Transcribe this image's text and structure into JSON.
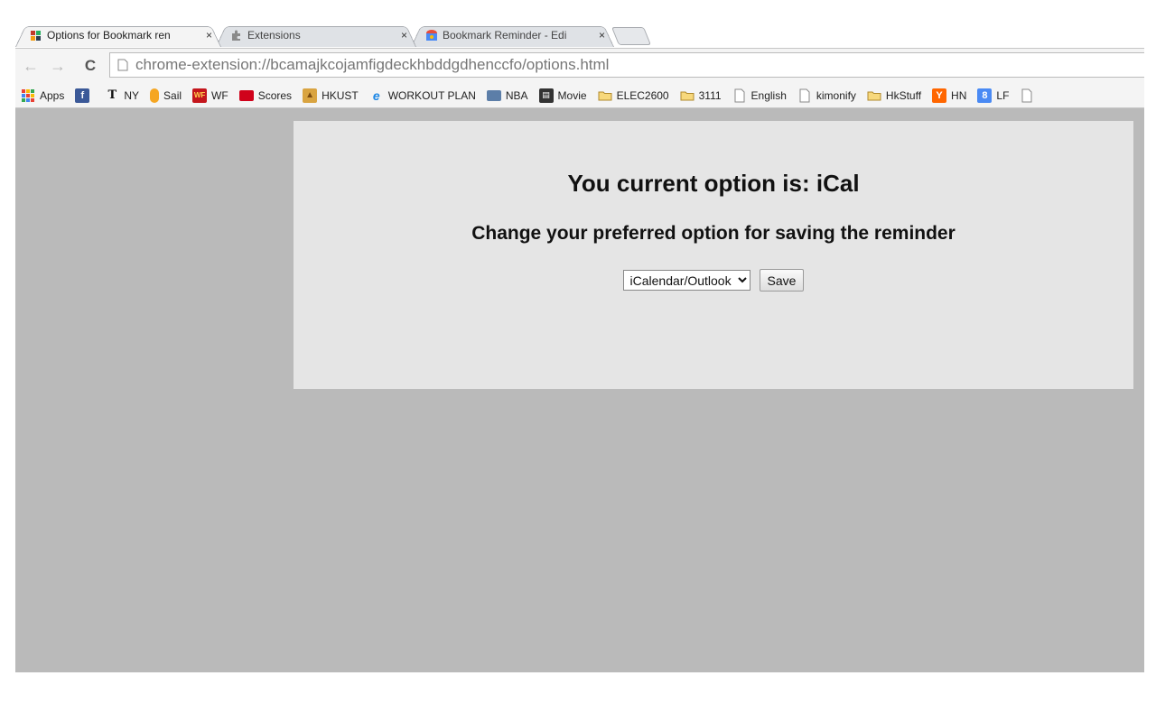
{
  "browser": {
    "tabs": [
      {
        "title": "Options for Bookmark ren",
        "active": true,
        "icon": "puzzle-colored-icon"
      },
      {
        "title": "Extensions",
        "active": false,
        "icon": "puzzle-gray-icon"
      },
      {
        "title": "Bookmark Reminder - Edi",
        "active": false,
        "icon": "webstore-icon"
      }
    ],
    "tab_close_glyph": "×",
    "address": "chrome-extension://bcamajkcojamfigdeckhbddgdhenccfo/options.html",
    "bookmarks": [
      {
        "label": "Apps",
        "icon": "apps-grid-icon"
      },
      {
        "label": "",
        "icon": "facebook-icon"
      },
      {
        "label": "NY",
        "icon": "nytimes-icon"
      },
      {
        "label": "Sail",
        "icon": "sail-icon"
      },
      {
        "label": "WF",
        "icon": "wellsfargo-icon"
      },
      {
        "label": "Scores",
        "icon": "espn-icon"
      },
      {
        "label": "HKUST",
        "icon": "hkust-icon"
      },
      {
        "label": "WORKOUT PLAN",
        "icon": "ie-icon"
      },
      {
        "label": "NBA",
        "icon": "computer-icon"
      },
      {
        "label": "Movie",
        "icon": "clapper-icon"
      },
      {
        "label": "ELEC2600",
        "icon": "folder-icon"
      },
      {
        "label": "3111",
        "icon": "folder-icon"
      },
      {
        "label": "English",
        "icon": "page-icon"
      },
      {
        "label": "kimonify",
        "icon": "page-icon"
      },
      {
        "label": "HkStuff",
        "icon": "folder-icon"
      },
      {
        "label": "HN",
        "icon": "ycombinator-icon"
      },
      {
        "label": "LF",
        "icon": "google-plus-icon"
      }
    ]
  },
  "options": {
    "current_option": "You current option is: iCal",
    "change_heading": "Change your preferred option for saving the reminder",
    "select_value": "iCalendar/Outlook",
    "save_label": "Save"
  }
}
